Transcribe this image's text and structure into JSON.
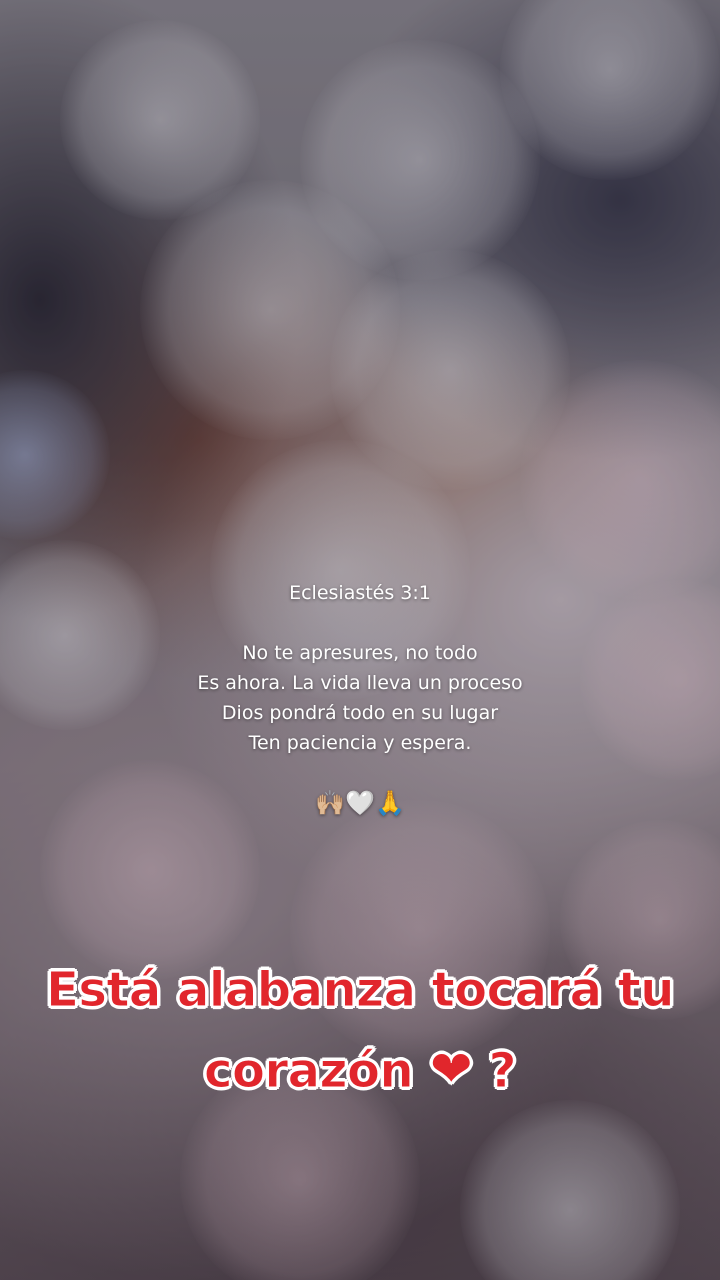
{
  "verse": {
    "reference": "Eclesiastés 3:1",
    "lines": [
      "No te apresures, no todo",
      "Es ahora. La vida lleva un proceso",
      "Dios pondrá todo en su lugar",
      "Ten paciencia y espera."
    ],
    "emojis": "🙌🏼🤍🙏"
  },
  "caption": {
    "line1": "Está alabanza tocará tu",
    "line2_text": "corazón",
    "line2_emoji": "❤",
    "line2_end": "?"
  },
  "colors": {
    "caption_fill": "#e1262c",
    "caption_outline": "#ffffff",
    "verse_text": "#ffffff"
  }
}
